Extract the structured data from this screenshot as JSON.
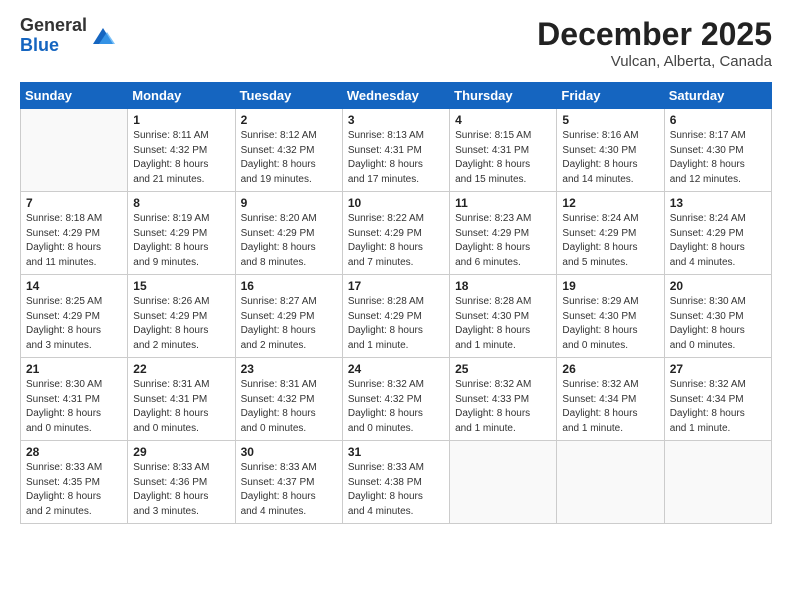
{
  "header": {
    "logo_general": "General",
    "logo_blue": "Blue",
    "title": "December 2025",
    "location": "Vulcan, Alberta, Canada"
  },
  "days_of_week": [
    "Sunday",
    "Monday",
    "Tuesday",
    "Wednesday",
    "Thursday",
    "Friday",
    "Saturday"
  ],
  "weeks": [
    [
      {
        "day": "",
        "info": ""
      },
      {
        "day": "1",
        "info": "Sunrise: 8:11 AM\nSunset: 4:32 PM\nDaylight: 8 hours\nand 21 minutes."
      },
      {
        "day": "2",
        "info": "Sunrise: 8:12 AM\nSunset: 4:32 PM\nDaylight: 8 hours\nand 19 minutes."
      },
      {
        "day": "3",
        "info": "Sunrise: 8:13 AM\nSunset: 4:31 PM\nDaylight: 8 hours\nand 17 minutes."
      },
      {
        "day": "4",
        "info": "Sunrise: 8:15 AM\nSunset: 4:31 PM\nDaylight: 8 hours\nand 15 minutes."
      },
      {
        "day": "5",
        "info": "Sunrise: 8:16 AM\nSunset: 4:30 PM\nDaylight: 8 hours\nand 14 minutes."
      },
      {
        "day": "6",
        "info": "Sunrise: 8:17 AM\nSunset: 4:30 PM\nDaylight: 8 hours\nand 12 minutes."
      }
    ],
    [
      {
        "day": "7",
        "info": "Sunrise: 8:18 AM\nSunset: 4:29 PM\nDaylight: 8 hours\nand 11 minutes."
      },
      {
        "day": "8",
        "info": "Sunrise: 8:19 AM\nSunset: 4:29 PM\nDaylight: 8 hours\nand 9 minutes."
      },
      {
        "day": "9",
        "info": "Sunrise: 8:20 AM\nSunset: 4:29 PM\nDaylight: 8 hours\nand 8 minutes."
      },
      {
        "day": "10",
        "info": "Sunrise: 8:22 AM\nSunset: 4:29 PM\nDaylight: 8 hours\nand 7 minutes."
      },
      {
        "day": "11",
        "info": "Sunrise: 8:23 AM\nSunset: 4:29 PM\nDaylight: 8 hours\nand 6 minutes."
      },
      {
        "day": "12",
        "info": "Sunrise: 8:24 AM\nSunset: 4:29 PM\nDaylight: 8 hours\nand 5 minutes."
      },
      {
        "day": "13",
        "info": "Sunrise: 8:24 AM\nSunset: 4:29 PM\nDaylight: 8 hours\nand 4 minutes."
      }
    ],
    [
      {
        "day": "14",
        "info": "Sunrise: 8:25 AM\nSunset: 4:29 PM\nDaylight: 8 hours\nand 3 minutes."
      },
      {
        "day": "15",
        "info": "Sunrise: 8:26 AM\nSunset: 4:29 PM\nDaylight: 8 hours\nand 2 minutes."
      },
      {
        "day": "16",
        "info": "Sunrise: 8:27 AM\nSunset: 4:29 PM\nDaylight: 8 hours\nand 2 minutes."
      },
      {
        "day": "17",
        "info": "Sunrise: 8:28 AM\nSunset: 4:29 PM\nDaylight: 8 hours\nand 1 minute."
      },
      {
        "day": "18",
        "info": "Sunrise: 8:28 AM\nSunset: 4:30 PM\nDaylight: 8 hours\nand 1 minute."
      },
      {
        "day": "19",
        "info": "Sunrise: 8:29 AM\nSunset: 4:30 PM\nDaylight: 8 hours\nand 0 minutes."
      },
      {
        "day": "20",
        "info": "Sunrise: 8:30 AM\nSunset: 4:30 PM\nDaylight: 8 hours\nand 0 minutes."
      }
    ],
    [
      {
        "day": "21",
        "info": "Sunrise: 8:30 AM\nSunset: 4:31 PM\nDaylight: 8 hours\nand 0 minutes."
      },
      {
        "day": "22",
        "info": "Sunrise: 8:31 AM\nSunset: 4:31 PM\nDaylight: 8 hours\nand 0 minutes."
      },
      {
        "day": "23",
        "info": "Sunrise: 8:31 AM\nSunset: 4:32 PM\nDaylight: 8 hours\nand 0 minutes."
      },
      {
        "day": "24",
        "info": "Sunrise: 8:32 AM\nSunset: 4:32 PM\nDaylight: 8 hours\nand 0 minutes."
      },
      {
        "day": "25",
        "info": "Sunrise: 8:32 AM\nSunset: 4:33 PM\nDaylight: 8 hours\nand 1 minute."
      },
      {
        "day": "26",
        "info": "Sunrise: 8:32 AM\nSunset: 4:34 PM\nDaylight: 8 hours\nand 1 minute."
      },
      {
        "day": "27",
        "info": "Sunrise: 8:32 AM\nSunset: 4:34 PM\nDaylight: 8 hours\nand 1 minute."
      }
    ],
    [
      {
        "day": "28",
        "info": "Sunrise: 8:33 AM\nSunset: 4:35 PM\nDaylight: 8 hours\nand 2 minutes."
      },
      {
        "day": "29",
        "info": "Sunrise: 8:33 AM\nSunset: 4:36 PM\nDaylight: 8 hours\nand 3 minutes."
      },
      {
        "day": "30",
        "info": "Sunrise: 8:33 AM\nSunset: 4:37 PM\nDaylight: 8 hours\nand 4 minutes."
      },
      {
        "day": "31",
        "info": "Sunrise: 8:33 AM\nSunset: 4:38 PM\nDaylight: 8 hours\nand 4 minutes."
      },
      {
        "day": "",
        "info": ""
      },
      {
        "day": "",
        "info": ""
      },
      {
        "day": "",
        "info": ""
      }
    ]
  ]
}
